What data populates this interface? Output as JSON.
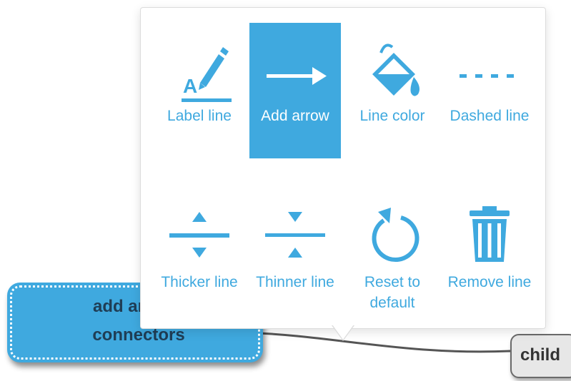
{
  "menu": {
    "items": [
      {
        "label": "Label line",
        "icon": "label-line-icon",
        "active": false
      },
      {
        "label": "Add arrow",
        "icon": "arrow-right-icon",
        "active": true
      },
      {
        "label": "Line color",
        "icon": "paint-bucket-icon",
        "active": false
      },
      {
        "label": "Dashed line",
        "icon": "dashed-line-icon",
        "active": false
      },
      {
        "label": "Thicker line",
        "icon": "thicker-line-icon",
        "active": false
      },
      {
        "label": "Thinner line",
        "icon": "thinner-line-icon",
        "active": false
      },
      {
        "label": "Reset to default",
        "icon": "reset-icon",
        "active": false
      },
      {
        "label": "Remove line",
        "icon": "trash-icon",
        "active": false
      }
    ]
  },
  "nodes": {
    "main": {
      "line1": "add arrows",
      "line2": "connectors"
    },
    "child": {
      "label": "child"
    }
  },
  "colors": {
    "accent": "#3fa9df",
    "node_text": "#1f3d55",
    "child_fill": "#e7e7e7"
  }
}
